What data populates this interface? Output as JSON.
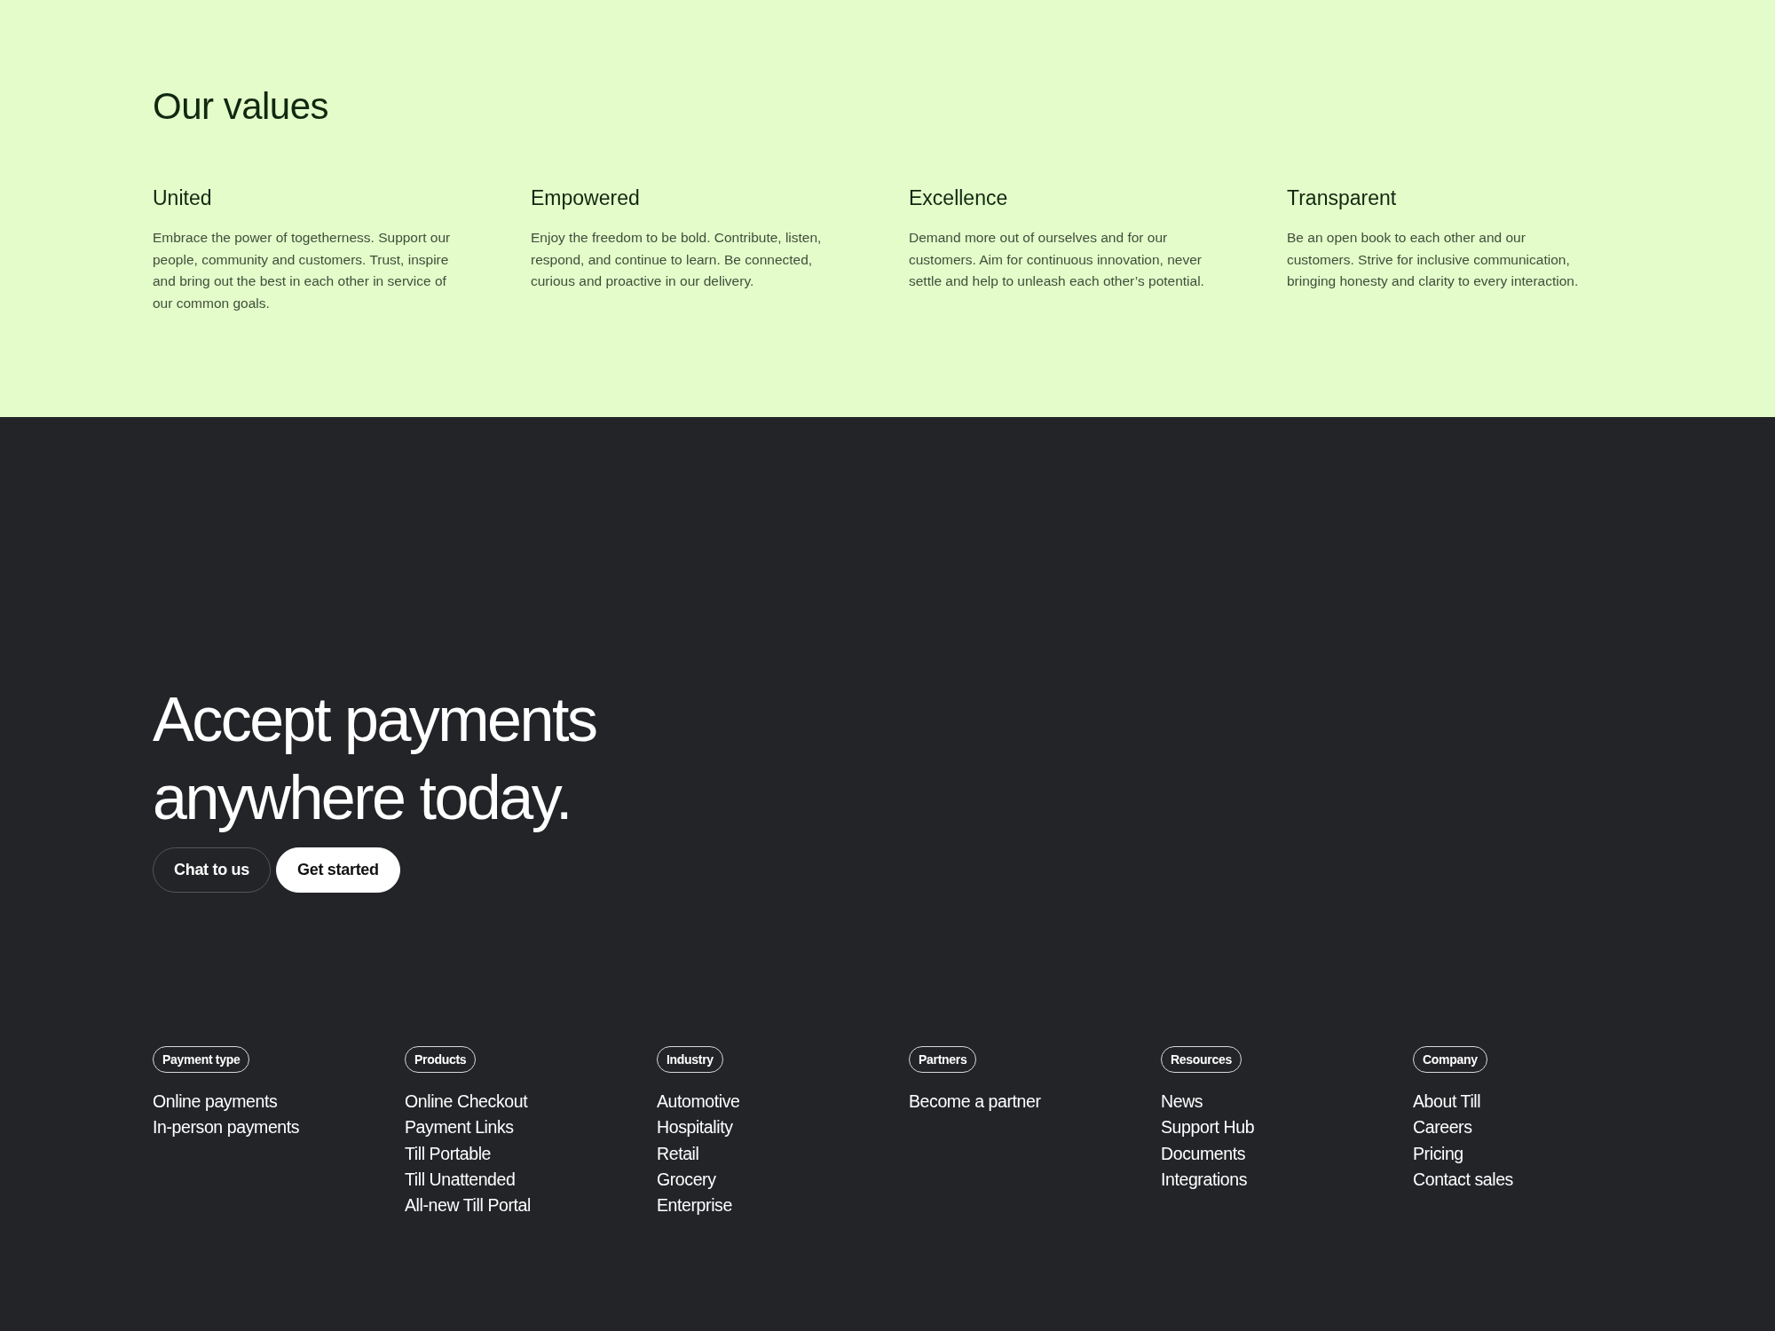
{
  "values_section": {
    "title": "Our values",
    "values": [
      {
        "heading": "United",
        "text": "Embrace the power of togetherness. Support our people, community and customers. Trust, inspire and bring out the best in each other in service of our common goals."
      },
      {
        "heading": "Empowered",
        "text": "Enjoy the freedom to be bold. Contribute, listen, respond, and continue to learn. Be connected, curious and proactive in our delivery."
      },
      {
        "heading": "Excellence",
        "text": "Demand more out of ourselves and for our customers. Aim for continuous innovation, never settle and help to unleash each other’s potential."
      },
      {
        "heading": "Transparent",
        "text": "Be an open book to each other and our customers. Strive for inclusive communication, bringing honesty and clarity to every interaction."
      }
    ]
  },
  "cta": {
    "headline_lines": [
      "Accept payments",
      "anywhere today."
    ],
    "buttons": [
      {
        "label": "Chat to us",
        "kind": "outline"
      },
      {
        "label": "Get started",
        "kind": "filled"
      }
    ]
  },
  "footer": {
    "columns": [
      {
        "tag": "Payment type",
        "links": [
          "Online payments",
          "In-person payments"
        ]
      },
      {
        "tag": "Products",
        "links": [
          "Online Checkout",
          "Payment Links",
          "Till Portable",
          "Till Unattended",
          "All-new Till Portal"
        ]
      },
      {
        "tag": "Industry",
        "links": [
          "Automotive",
          "Hospitality",
          "Retail",
          "Grocery",
          "Enterprise"
        ]
      },
      {
        "tag": "Partners",
        "links": [
          "Become a partner"
        ]
      },
      {
        "tag": "Resources",
        "links": [
          "News",
          "Support Hub",
          "Documents",
          "Integrations"
        ]
      },
      {
        "tag": "Company",
        "links": [
          "About Till",
          "Careers",
          "Pricing",
          "Contact sales"
        ]
      }
    ]
  }
}
